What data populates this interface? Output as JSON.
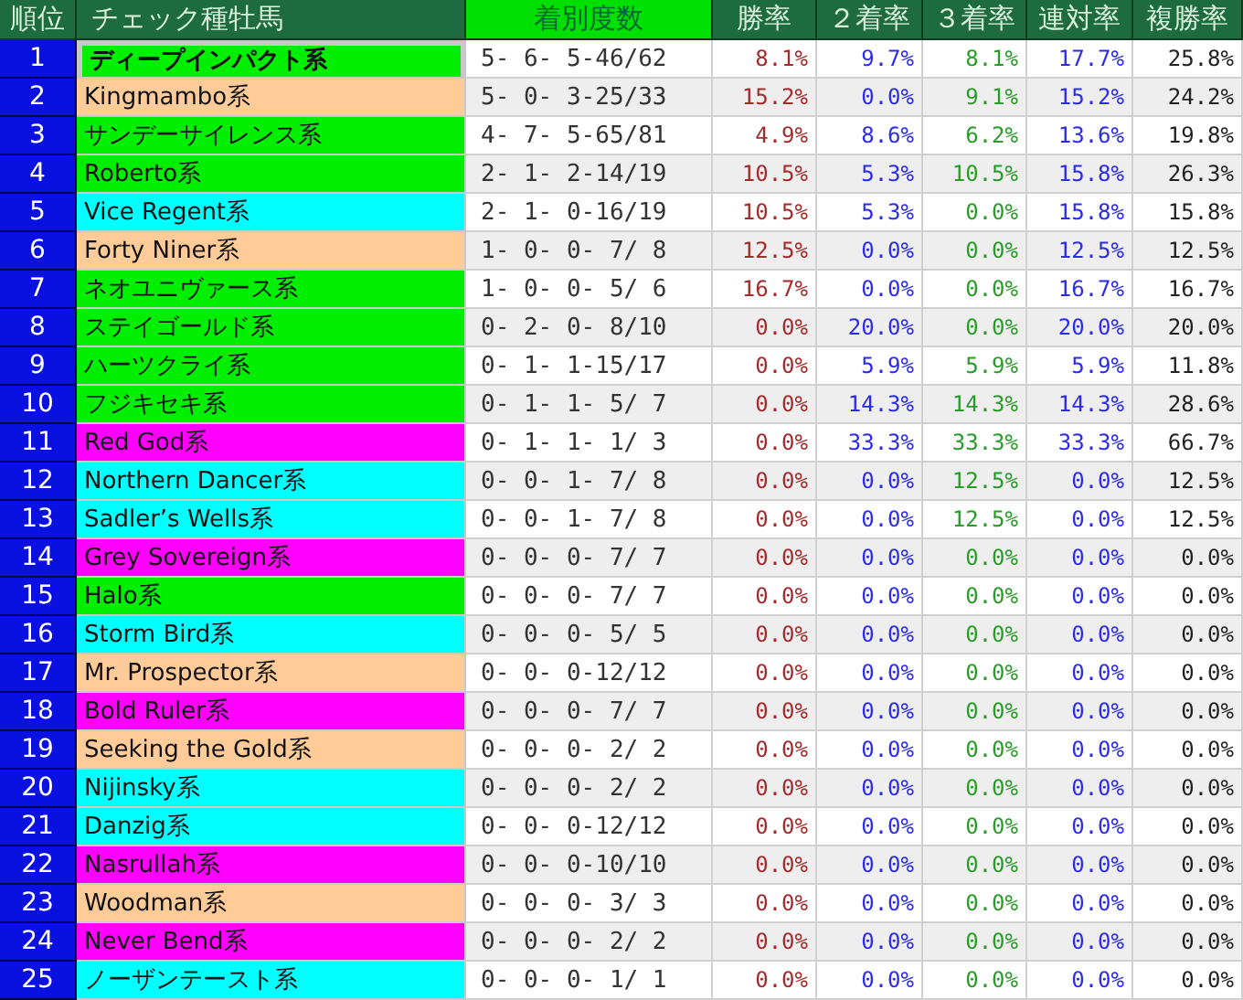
{
  "table": {
    "columns": [
      "順位",
      "チェック種牡馬",
      "着別度数",
      "勝率",
      "２着率",
      "３着率",
      "連対率",
      "複勝率"
    ],
    "rows": [
      {
        "rank": "1",
        "sire": "ディープインパクト系",
        "color": "#00ee00",
        "selected": true,
        "record": "5- 6- 5-46/62",
        "win_rate": "8.1%",
        "second_rate": "9.7%",
        "third_rate": "8.1%",
        "top2_rate": "17.7%",
        "top3_rate": "25.8%"
      },
      {
        "rank": "2",
        "sire": "Kingmambo系",
        "color": "#ffcc99",
        "selected": false,
        "record": "5- 0- 3-25/33",
        "win_rate": "15.2%",
        "second_rate": "0.0%",
        "third_rate": "9.1%",
        "top2_rate": "15.2%",
        "top3_rate": "24.2%"
      },
      {
        "rank": "3",
        "sire": "サンデーサイレンス系",
        "color": "#00ee00",
        "selected": false,
        "record": "4- 7- 5-65/81",
        "win_rate": "4.9%",
        "second_rate": "8.6%",
        "third_rate": "6.2%",
        "top2_rate": "13.6%",
        "top3_rate": "19.8%"
      },
      {
        "rank": "4",
        "sire": "Roberto系",
        "color": "#00ee00",
        "selected": false,
        "record": "2- 1- 2-14/19",
        "win_rate": "10.5%",
        "second_rate": "5.3%",
        "third_rate": "10.5%",
        "top2_rate": "15.8%",
        "top3_rate": "26.3%"
      },
      {
        "rank": "5",
        "sire": "Vice Regent系",
        "color": "#00ffff",
        "selected": false,
        "record": "2- 1- 0-16/19",
        "win_rate": "10.5%",
        "second_rate": "5.3%",
        "third_rate": "0.0%",
        "top2_rate": "15.8%",
        "top3_rate": "15.8%"
      },
      {
        "rank": "6",
        "sire": "Forty Niner系",
        "color": "#ffcc99",
        "selected": false,
        "record": "1- 0- 0- 7/ 8",
        "win_rate": "12.5%",
        "second_rate": "0.0%",
        "third_rate": "0.0%",
        "top2_rate": "12.5%",
        "top3_rate": "12.5%"
      },
      {
        "rank": "7",
        "sire": "ネオユニヴァース系",
        "color": "#00ee00",
        "selected": false,
        "record": "1- 0- 0- 5/ 6",
        "win_rate": "16.7%",
        "second_rate": "0.0%",
        "third_rate": "0.0%",
        "top2_rate": "16.7%",
        "top3_rate": "16.7%"
      },
      {
        "rank": "8",
        "sire": "ステイゴールド系",
        "color": "#00ee00",
        "selected": false,
        "record": "0- 2- 0- 8/10",
        "win_rate": "0.0%",
        "second_rate": "20.0%",
        "third_rate": "0.0%",
        "top2_rate": "20.0%",
        "top3_rate": "20.0%"
      },
      {
        "rank": "9",
        "sire": "ハーツクライ系",
        "color": "#00ee00",
        "selected": false,
        "record": "0- 1- 1-15/17",
        "win_rate": "0.0%",
        "second_rate": "5.9%",
        "third_rate": "5.9%",
        "top2_rate": "5.9%",
        "top3_rate": "11.8%"
      },
      {
        "rank": "10",
        "sire": "フジキセキ系",
        "color": "#00ee00",
        "selected": false,
        "record": "0- 1- 1- 5/ 7",
        "win_rate": "0.0%",
        "second_rate": "14.3%",
        "third_rate": "14.3%",
        "top2_rate": "14.3%",
        "top3_rate": "28.6%"
      },
      {
        "rank": "11",
        "sire": "Red God系",
        "color": "#ff00ff",
        "selected": false,
        "record": "0- 1- 1- 1/ 3",
        "win_rate": "0.0%",
        "second_rate": "33.3%",
        "third_rate": "33.3%",
        "top2_rate": "33.3%",
        "top3_rate": "66.7%"
      },
      {
        "rank": "12",
        "sire": "Northern Dancer系",
        "color": "#00ffff",
        "selected": false,
        "record": "0- 0- 1- 7/ 8",
        "win_rate": "0.0%",
        "second_rate": "0.0%",
        "third_rate": "12.5%",
        "top2_rate": "0.0%",
        "top3_rate": "12.5%"
      },
      {
        "rank": "13",
        "sire": "Sadler’s Wells系",
        "color": "#00ffff",
        "selected": false,
        "record": "0- 0- 1- 7/ 8",
        "win_rate": "0.0%",
        "second_rate": "0.0%",
        "third_rate": "12.5%",
        "top2_rate": "0.0%",
        "top3_rate": "12.5%"
      },
      {
        "rank": "14",
        "sire": "Grey Sovereign系",
        "color": "#ff00ff",
        "selected": false,
        "record": "0- 0- 0- 7/ 7",
        "win_rate": "0.0%",
        "second_rate": "0.0%",
        "third_rate": "0.0%",
        "top2_rate": "0.0%",
        "top3_rate": "0.0%"
      },
      {
        "rank": "15",
        "sire": "Halo系",
        "color": "#00ee00",
        "selected": false,
        "record": "0- 0- 0- 7/ 7",
        "win_rate": "0.0%",
        "second_rate": "0.0%",
        "third_rate": "0.0%",
        "top2_rate": "0.0%",
        "top3_rate": "0.0%"
      },
      {
        "rank": "16",
        "sire": "Storm Bird系",
        "color": "#00ffff",
        "selected": false,
        "record": "0- 0- 0- 5/ 5",
        "win_rate": "0.0%",
        "second_rate": "0.0%",
        "third_rate": "0.0%",
        "top2_rate": "0.0%",
        "top3_rate": "0.0%"
      },
      {
        "rank": "17",
        "sire": "Mr. Prospector系",
        "color": "#ffcc99",
        "selected": false,
        "record": "0- 0- 0-12/12",
        "win_rate": "0.0%",
        "second_rate": "0.0%",
        "third_rate": "0.0%",
        "top2_rate": "0.0%",
        "top3_rate": "0.0%"
      },
      {
        "rank": "18",
        "sire": "Bold Ruler系",
        "color": "#ff00ff",
        "selected": false,
        "record": "0- 0- 0- 7/ 7",
        "win_rate": "0.0%",
        "second_rate": "0.0%",
        "third_rate": "0.0%",
        "top2_rate": "0.0%",
        "top3_rate": "0.0%"
      },
      {
        "rank": "19",
        "sire": "Seeking the Gold系",
        "color": "#ffcc99",
        "selected": false,
        "record": "0- 0- 0- 2/ 2",
        "win_rate": "0.0%",
        "second_rate": "0.0%",
        "third_rate": "0.0%",
        "top2_rate": "0.0%",
        "top3_rate": "0.0%"
      },
      {
        "rank": "20",
        "sire": "Nijinsky系",
        "color": "#00ffff",
        "selected": false,
        "record": "0- 0- 0- 2/ 2",
        "win_rate": "0.0%",
        "second_rate": "0.0%",
        "third_rate": "0.0%",
        "top2_rate": "0.0%",
        "top3_rate": "0.0%"
      },
      {
        "rank": "21",
        "sire": "Danzig系",
        "color": "#00ffff",
        "selected": false,
        "record": "0- 0- 0-12/12",
        "win_rate": "0.0%",
        "second_rate": "0.0%",
        "third_rate": "0.0%",
        "top2_rate": "0.0%",
        "top3_rate": "0.0%"
      },
      {
        "rank": "22",
        "sire": "Nasrullah系",
        "color": "#ff00ff",
        "selected": false,
        "record": "0- 0- 0-10/10",
        "win_rate": "0.0%",
        "second_rate": "0.0%",
        "third_rate": "0.0%",
        "top2_rate": "0.0%",
        "top3_rate": "0.0%"
      },
      {
        "rank": "23",
        "sire": "Woodman系",
        "color": "#ffcc99",
        "selected": false,
        "record": "0- 0- 0- 3/ 3",
        "win_rate": "0.0%",
        "second_rate": "0.0%",
        "third_rate": "0.0%",
        "top2_rate": "0.0%",
        "top3_rate": "0.0%"
      },
      {
        "rank": "24",
        "sire": "Never Bend系",
        "color": "#ff00ff",
        "selected": false,
        "record": "0- 0- 0- 2/ 2",
        "win_rate": "0.0%",
        "second_rate": "0.0%",
        "third_rate": "0.0%",
        "top2_rate": "0.0%",
        "top3_rate": "0.0%"
      },
      {
        "rank": "25",
        "sire": "ノーザンテースト系",
        "color": "#00ffff",
        "selected": false,
        "record": "0- 0- 0- 1/ 1",
        "win_rate": "0.0%",
        "second_rate": "0.0%",
        "third_rate": "0.0%",
        "top2_rate": "0.0%",
        "top3_rate": "0.0%"
      }
    ]
  }
}
